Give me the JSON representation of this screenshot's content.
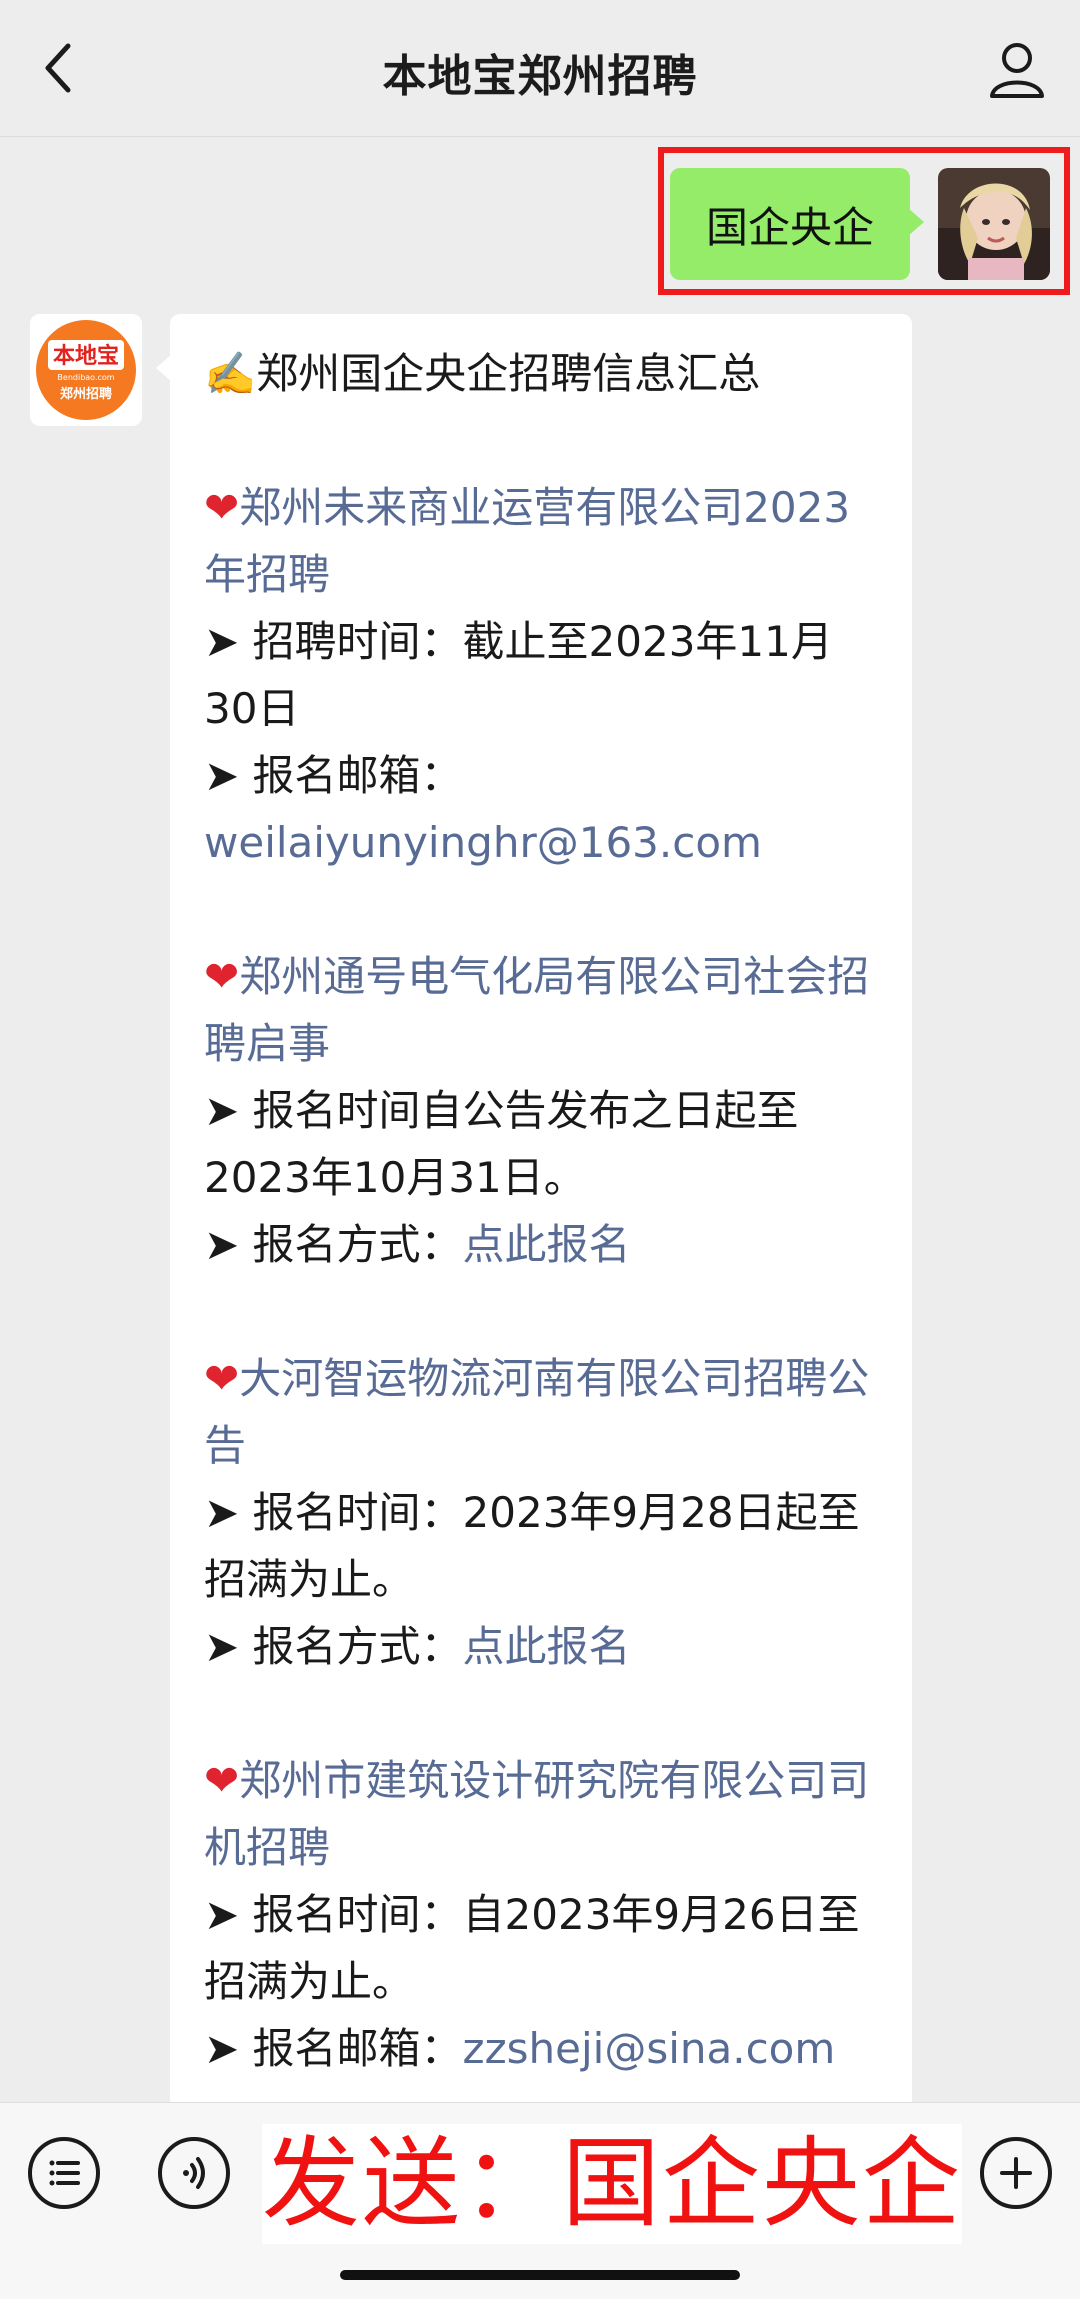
{
  "header": {
    "title": "本地宝郑州招聘",
    "back_icon": "chevron-left-icon",
    "profile_icon": "person-icon"
  },
  "outgoing": {
    "text": "国企央企"
  },
  "brand_avatar": {
    "top_text": "本地宝",
    "mid_text": "Bendibao.com",
    "bottom_text": "郑州招聘",
    "color": "#f47920"
  },
  "message": {
    "heading": "✍️郑州国企央企招聘信息汇总",
    "items": [
      {
        "title": "郑州未来商业运营有限公司2023年招聘",
        "line1_label": "➤ 招聘时间：截止至2023年11月30日",
        "line2_label": "➤ 报名邮箱：",
        "line2_value": "weilaiyunyinghr@163.com"
      },
      {
        "title": "郑州通号电气化局有限公司社会招聘启事",
        "line1_label": "➤ 报名时间自公告发布之日起至2023年10月31日。",
        "line2_label": "➤ 报名方式：",
        "line2_value": "点此报名"
      },
      {
        "title": "大河智运物流河南有限公司招聘公告",
        "line1_label": "➤ 报名时间：2023年9月28日起至招满为止。",
        "line2_label": "➤ 报名方式：",
        "line2_value": "点此报名"
      },
      {
        "title": "郑州市建筑设计研究院有限公司司机招聘",
        "line1_label": "➤ 报名时间：自2023年9月26日至招满为止。",
        "line2_label": "➤ 报名邮箱：",
        "line2_value": "zzsheji@sina.com"
      }
    ]
  },
  "bottom": {
    "overlay_text": "发送：国企央企",
    "menu_icon": "list-icon",
    "voice_icon": "voice-icon",
    "emoji_icon": "emoji-icon",
    "plus_icon": "plus-icon"
  },
  "colors": {
    "link": "#576b95",
    "outgoing_bubble": "#95ec69",
    "highlight": "#f01c1c"
  }
}
